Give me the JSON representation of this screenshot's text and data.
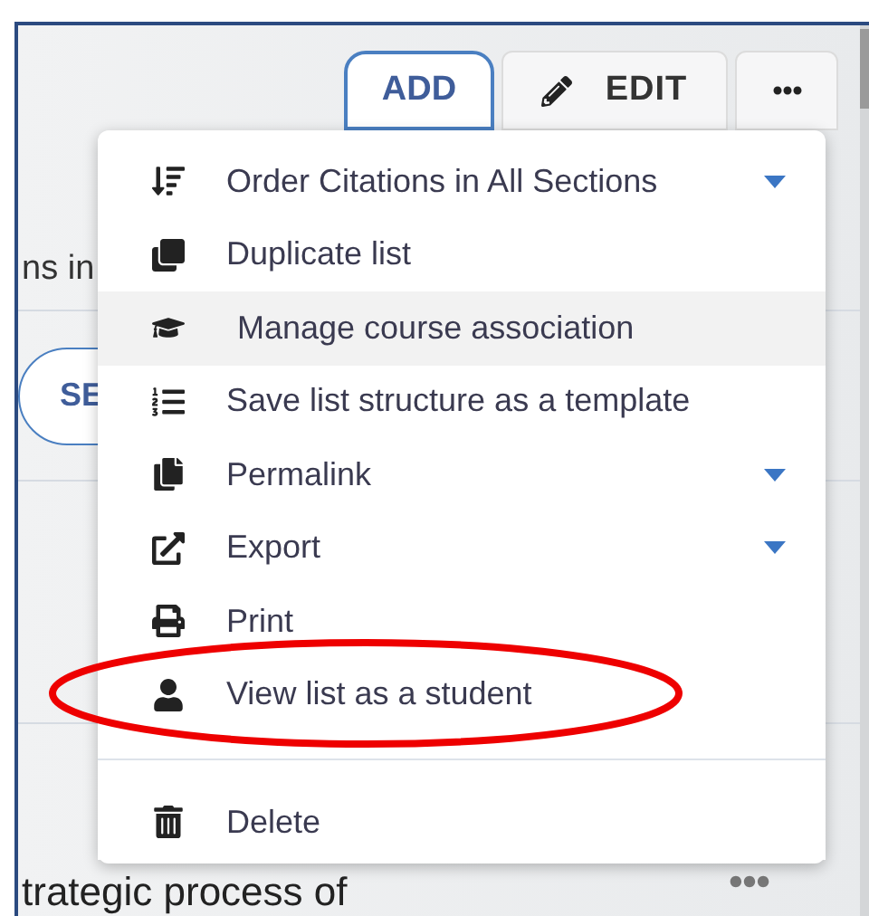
{
  "toolbar": {
    "buttons": [
      {
        "kind": "add",
        "label": "ADD",
        "selected": true
      },
      {
        "kind": "edit",
        "label": "EDIT",
        "selected": false
      },
      {
        "kind": "more",
        "selected": false
      }
    ]
  },
  "background": {
    "text_1": "ns in",
    "button": "SE",
    "text_2": "trategic process of"
  },
  "menu": {
    "items": [
      {
        "kind": "order",
        "label": "Order Citations in All Sections",
        "has_submenu": true,
        "selected": false,
        "circled": false
      },
      {
        "kind": "duplicate",
        "label": "Duplicate list",
        "has_submenu": false,
        "selected": false,
        "circled": false
      },
      {
        "kind": "course",
        "label": "Manage course association",
        "has_submenu": false,
        "selected": true,
        "circled": false
      },
      {
        "kind": "template",
        "label": "Save list structure as a template",
        "has_submenu": false,
        "selected": false,
        "circled": false
      },
      {
        "kind": "permalink",
        "label": "Permalink",
        "has_submenu": true,
        "selected": false,
        "circled": false
      },
      {
        "kind": "export",
        "label": "Export",
        "has_submenu": true,
        "selected": false,
        "circled": false
      },
      {
        "kind": "print",
        "label": "Print",
        "has_submenu": false,
        "selected": false,
        "circled": false
      },
      {
        "kind": "student",
        "label": "View list as a student",
        "has_submenu": false,
        "selected": false,
        "circled": true
      }
    ],
    "footer_items": [
      {
        "kind": "delete",
        "label": "Delete",
        "has_submenu": false,
        "selected": false,
        "circled": false
      }
    ]
  }
}
